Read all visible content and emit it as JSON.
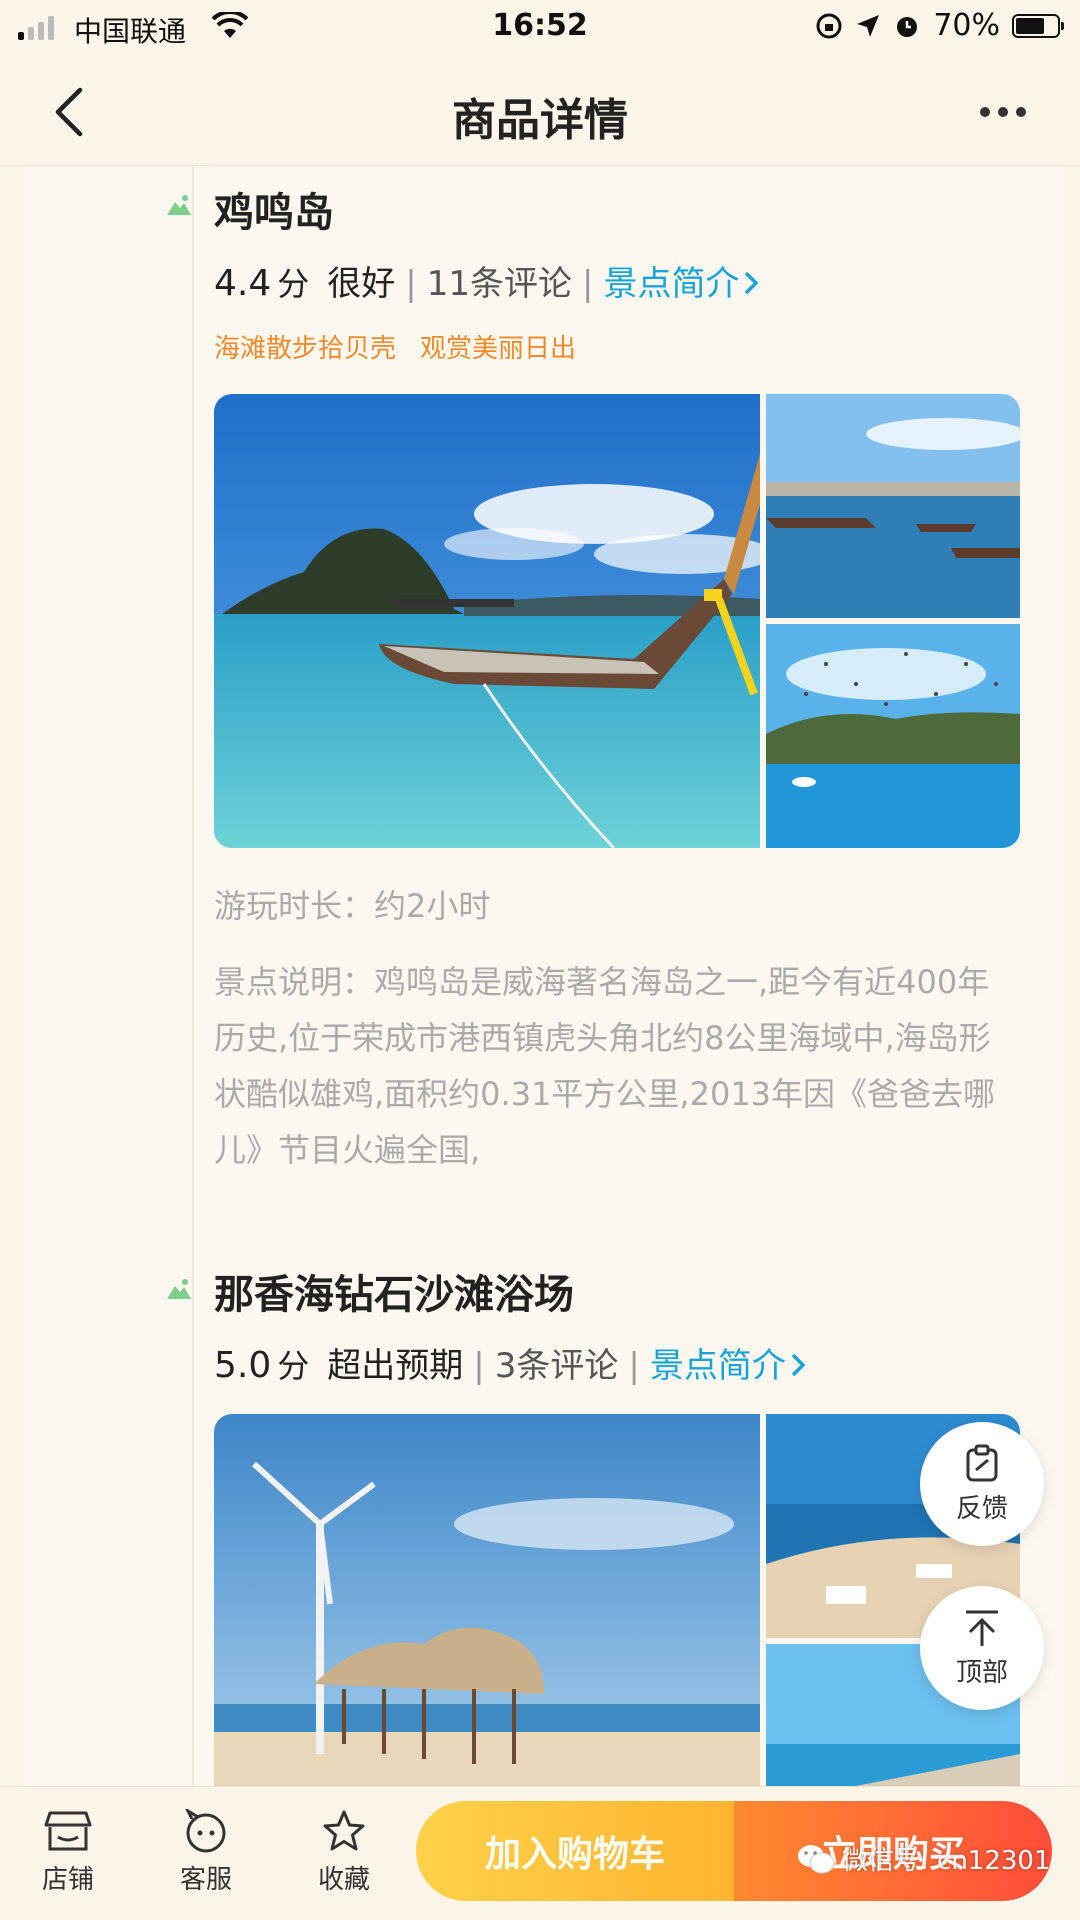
{
  "status_bar": {
    "carrier": "中国联通",
    "time": "16:52",
    "battery": "70%",
    "battery_level": 0.7
  },
  "nav": {
    "title": "商品详情"
  },
  "spots": [
    {
      "title": "鸡鸣岛",
      "score": "4.4",
      "score_unit": "分",
      "rating_word": "很好",
      "reviews": "11条评论",
      "intro_link": "景点简介",
      "tags": [
        "海滩散步拾贝壳",
        "观赏美丽日出"
      ],
      "duration": "游玩时长：约2小时",
      "description": "景点说明：鸡鸣岛是威海著名海岛之一,距今有近400年历史,位于荣成市港西镇虎头角北约8公里海域中,海岛形状酷似雄鸡,面积约0.31平方公里,2013年因《爸爸去哪儿》节目火遍全国,"
    },
    {
      "title": "那香海钻石沙滩浴场",
      "score": "5.0",
      "score_unit": "分",
      "rating_word": "超出预期",
      "reviews": "3条评论",
      "intro_link": "景点简介"
    }
  ],
  "separator": "|",
  "float_buttons": {
    "feedback": "反馈",
    "top": "顶部"
  },
  "bottom_bar": {
    "store": "店铺",
    "service": "客服",
    "favorite": "收藏",
    "add_cart": "加入购物车",
    "buy_now": "立即购买"
  },
  "watermark": "微信号: cn12301",
  "colors": {
    "accent_blue": "#1aa3d6",
    "tag_orange": "#f08a2c",
    "cart_yellow": "#ffb42e",
    "buy_red": "#ff4d3a"
  },
  "icons": [
    "back-icon",
    "more-icon",
    "spot-icon",
    "feedback-icon",
    "arrow-up-icon",
    "store-icon",
    "service-icon",
    "star-icon",
    "wechat-icon"
  ]
}
